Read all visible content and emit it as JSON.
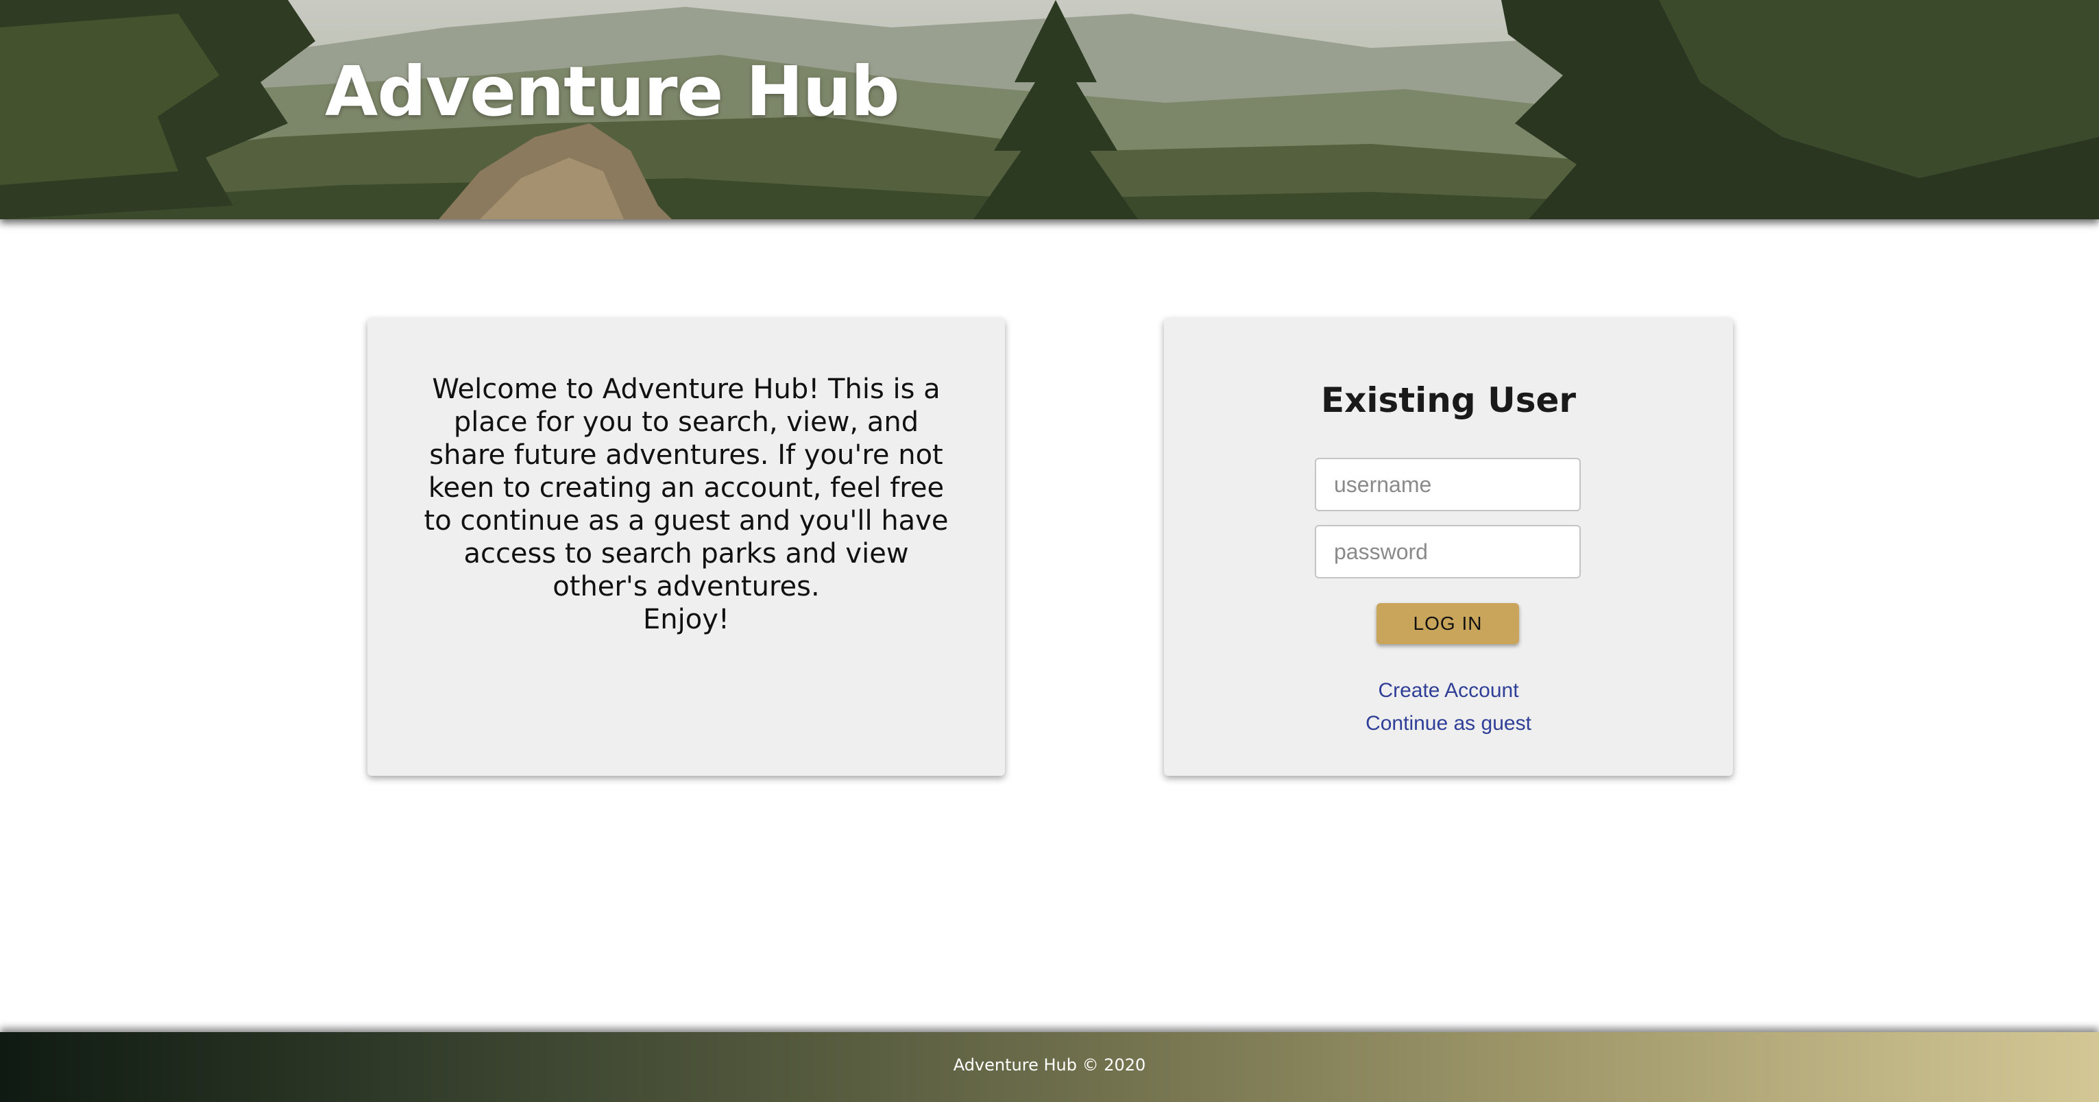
{
  "header": {
    "title": "Adventure Hub"
  },
  "welcome": {
    "body": "Welcome to Adventure Hub! This is a place for you to search, view, and share future adventures. If you're not keen to creating an account, feel free to continue as a guest and you'll have access to search parks and view other's adventures.",
    "closing": "Enjoy!"
  },
  "login": {
    "heading": "Existing User",
    "username_placeholder": "username",
    "password_placeholder": "password",
    "button_label": "LOG IN",
    "create_account_label": "Create Account",
    "guest_label": "Continue as guest"
  },
  "footer": {
    "text": "Adventure Hub © 2020"
  },
  "colors": {
    "button": "#c9a55c",
    "link": "#2f3e96",
    "card": "#efefef"
  }
}
